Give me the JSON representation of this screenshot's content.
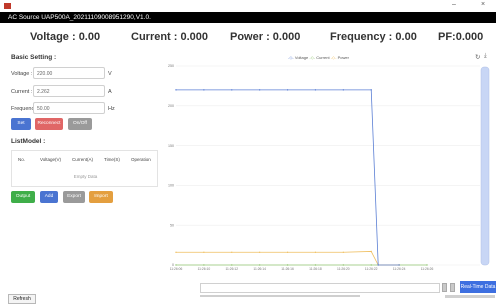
{
  "window": {
    "title": "",
    "app_bar_title": "AC Source UAP500A_20211109008951290,V1.0.",
    "minimize": "–",
    "close": "×"
  },
  "metrics": {
    "voltage": "Voltage : 0.00",
    "current": "Current : 0.000",
    "power": "Power : 0.000",
    "frequency": "Frequency : 0.00",
    "pf": "PF:0.000"
  },
  "basic": {
    "title": "Basic Setting :",
    "voltage_label": "Voltage :",
    "voltage_value": "220.00",
    "voltage_unit": "V",
    "current_label": "Current :",
    "current_value": "2.262",
    "current_unit": "A",
    "frequency_label": "Frequency :",
    "frequency_value": "50.00",
    "frequency_unit": "Hz",
    "set_button": "Set",
    "reconnect_button": "Reconnect",
    "onoff_button": "On/Off"
  },
  "list": {
    "title": "ListModel :",
    "columns": [
      "No.",
      "Voltage(V)",
      "Current(A)",
      "Time(S)",
      "Operation"
    ],
    "empty_text": "Empty Data",
    "output_button": "Output",
    "add_button": "Add",
    "export_button": "Export",
    "import_button": "Import"
  },
  "colors": {
    "blue": "#4a74d1",
    "red": "#e06666",
    "gray": "#9a9a9a",
    "green": "#3fae49",
    "orange": "#e49f3f",
    "voltage_series": "#5b7fd4",
    "current_series": "#8fc36e",
    "power_series": "#efbe5e"
  },
  "chart_data": {
    "type": "line",
    "legend": [
      "Voltage",
      "Current",
      "Power"
    ],
    "legend_position": "top-center",
    "ylim": [
      0,
      250
    ],
    "yticks": [
      0,
      50,
      100,
      150,
      200,
      250
    ],
    "x": [
      "11:26:06",
      "11:26:10",
      "11:26:12",
      "11:26:14",
      "11:26:16",
      "11:26:18",
      "11:26:20",
      "11:26:22",
      "11:26:24",
      "11:26:26"
    ],
    "series": [
      {
        "name": "Voltage",
        "values": [
          220,
          220,
          220,
          220,
          220,
          220,
          220,
          220,
          0,
          0
        ]
      },
      {
        "name": "Current",
        "values": [
          0,
          0,
          0,
          0,
          0,
          0,
          0,
          0,
          0,
          0
        ]
      },
      {
        "name": "Power",
        "values": [
          16,
          16,
          16,
          16,
          16,
          16,
          16,
          17,
          0,
          0
        ]
      }
    ],
    "grid": true
  },
  "bottom": {
    "refresh_button": "Refresh",
    "realtime_button": "Real-Time Data"
  },
  "icons": {
    "refresh": "refresh-icon",
    "download": "download-icon"
  }
}
